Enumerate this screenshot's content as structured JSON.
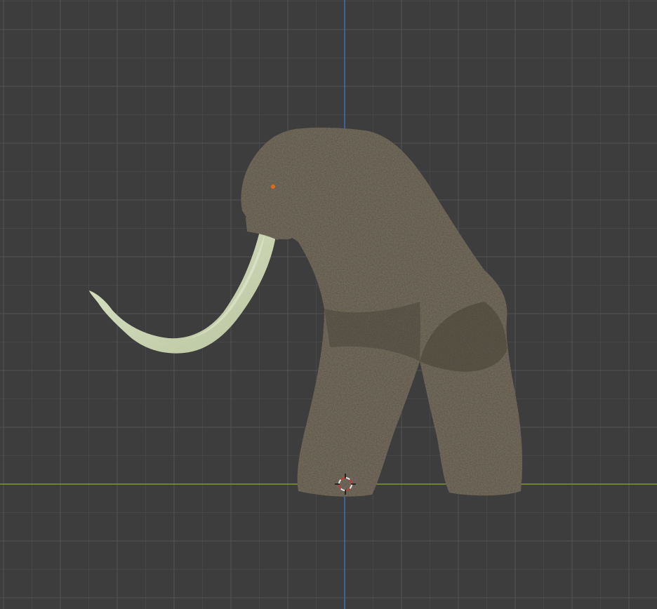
{
  "viewport": {
    "background": "#3d3d3d",
    "grid_minor_color": "#474747",
    "grid_major_color": "#545454",
    "x_axis_color": "#7f9a2e",
    "z_axis_color": "#3f6fb5",
    "grid_visible": true
  },
  "object": {
    "name_icon": "mammoth-model",
    "fur_color": "#5c5446",
    "fur_shadow_color": "#453f35",
    "tusk_color": "#c9d4b4",
    "eye_color": "#e06a1c"
  },
  "cursor": {
    "icon": "3d-cursor-icon",
    "ring_color": "#e8e8e8",
    "accent_color": "#c23a3a"
  }
}
